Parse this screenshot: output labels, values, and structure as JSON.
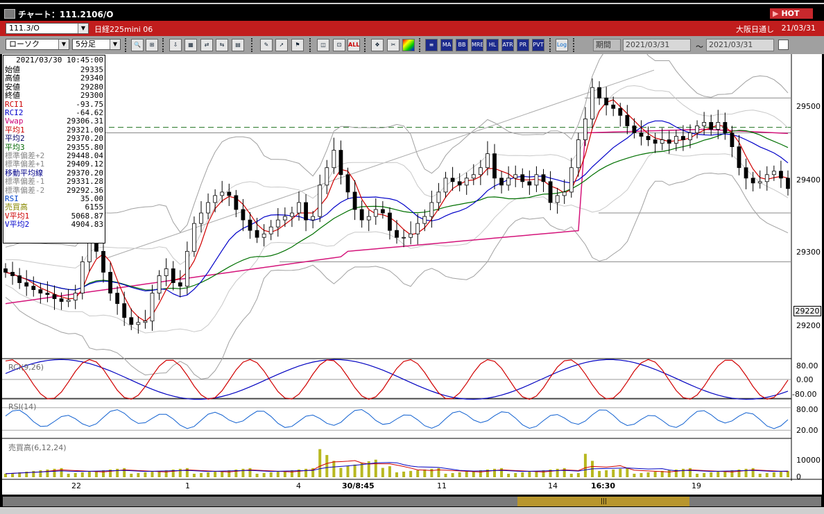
{
  "window": {
    "title": "チャート：111.2106/O",
    "hot_label": "HOT"
  },
  "info_strip": {
    "symbol_value": "111.3/O",
    "symbol_name": "日経225mini 06",
    "chart_type": "ローソク",
    "interval": "5分足",
    "market": "大阪日通し",
    "date": "21/03/31"
  },
  "toolbar": {
    "icons": [
      "zoom-icon",
      "cursor-split-icon",
      "arrow-down-icon",
      "image-icon",
      "swap-icon",
      "trash-icon",
      "pen-icon",
      "arrow-select-icon",
      "flag-icon",
      "bar-shift-icon",
      "bar-split-icon",
      "all-icon",
      "lattice-icon",
      "wrench-icon",
      "palette-icon",
      "price-band-icon",
      "ma-icon",
      "bb-icon",
      "mre-icon",
      "hl-icon",
      "atr-icon",
      "pr-icon",
      "pvt-icon",
      "log-icon"
    ],
    "btn_labels": {
      "all": "ALL",
      "ma": "MA",
      "bb": "BB",
      "mre": "MRE",
      "hl": "HL",
      "atr": "ATR",
      "pr": "PR",
      "pvt": "PVT",
      "log": "Log"
    },
    "period_label": "期間",
    "date_from": "2021/03/31",
    "tilde": "〜",
    "date_to": "2021/03/31"
  },
  "info_panel": {
    "timestamp": "2021/03/30 10:45:00",
    "rows": [
      {
        "label": "始値",
        "value": "29335",
        "color": "#000000"
      },
      {
        "label": "高値",
        "value": "29340",
        "color": "#000000"
      },
      {
        "label": "安値",
        "value": "29280",
        "color": "#000000"
      },
      {
        "label": "終値",
        "value": "29300",
        "color": "#000000"
      },
      {
        "label": "RCI1",
        "value": "-93.75",
        "color": "#cc0000"
      },
      {
        "label": "RCI2",
        "value": "-64.62",
        "color": "#0000cc"
      },
      {
        "label": "Vwap",
        "value": "29306.31",
        "color": "#cc0077"
      },
      {
        "label": "平均1",
        "value": "29321.00",
        "color": "#cc0000"
      },
      {
        "label": "平均2",
        "value": "29370.20",
        "color": "#000066"
      },
      {
        "label": "平均3",
        "value": "29355.80",
        "color": "#006600"
      },
      {
        "label": "標準偏差+2",
        "value": "29448.04",
        "color": "#888888"
      },
      {
        "label": "標準偏差+1",
        "value": "29409.12",
        "color": "#888888"
      },
      {
        "label": "移動平均線",
        "value": "29370.20",
        "color": "#000088"
      },
      {
        "label": "標準偏差-1",
        "value": "29331.28",
        "color": "#888888"
      },
      {
        "label": "標準偏差-2",
        "value": "29292.36",
        "color": "#888888"
      },
      {
        "label": "RSI",
        "value": "35.00",
        "color": "#0044cc"
      },
      {
        "label": "売買高",
        "value": "6155",
        "color": "#888800"
      },
      {
        "label": "V平均1",
        "value": "5068.87",
        "color": "#cc0000"
      },
      {
        "label": "V平均2",
        "value": "4904.83",
        "color": "#0000cc"
      }
    ]
  },
  "price_axis": {
    "ticks": [
      "29500",
      "29400",
      "29300",
      "29200"
    ],
    "current_price": "29220"
  },
  "panes": {
    "rci_label": "RCI(9,26)",
    "rci_ticks": [
      "80.00",
      "0.00",
      "-80.00"
    ],
    "rsi_label": "RSI(14)",
    "rsi_ticks": [
      "80.00",
      "20.00"
    ],
    "vol_label": "売買高(6,12,24)",
    "vol_ticks": [
      "10000",
      "0"
    ]
  },
  "time_axis": {
    "labels": [
      "22",
      "1",
      "4",
      "30/8:45",
      "11",
      "14",
      "16:30",
      "19"
    ]
  },
  "colors": {
    "vwap": "#d4147a",
    "ma1": "#d00000",
    "ma2": "#0000c8",
    "ma3": "#007000",
    "bb": "#a0a0a0",
    "rci1": "#d00000",
    "rci2": "#0000c0",
    "rsi": "#1060d0",
    "vol": "#b8b820"
  },
  "chart_data": {
    "type": "candlestick",
    "ylim": [
      29160,
      29570
    ],
    "close_series": [
      29270,
      29265,
      29255,
      29250,
      29245,
      29240,
      29238,
      29232,
      29228,
      29230,
      29240,
      29285,
      29330,
      29300,
      29270,
      29240,
      29225,
      29205,
      29195,
      29198,
      29200,
      29240,
      29265,
      29275,
      29255,
      29250,
      29300,
      29340,
      29355,
      29370,
      29380,
      29385,
      29380,
      29360,
      29345,
      29330,
      29320,
      29325,
      29335,
      29345,
      29350,
      29355,
      29370,
      29345,
      29350,
      29395,
      29420,
      29445,
      29410,
      29385,
      29360,
      29345,
      29350,
      29360,
      29355,
      29330,
      29320,
      29320,
      29325,
      29340,
      29350,
      29370,
      29385,
      29405,
      29400,
      29395,
      29405,
      29410,
      29420,
      29440,
      29405,
      29395,
      29405,
      29410,
      29400,
      29395,
      29410,
      29400,
      29370,
      29380,
      29385,
      29420,
      29460,
      29490,
      29535,
      29520,
      29510,
      29505,
      29495,
      29480,
      29470,
      29465,
      29460,
      29455,
      29460,
      29455,
      29465,
      29460,
      29470,
      29480,
      29485,
      29475,
      29485,
      29470,
      29450,
      29420,
      29405,
      29398,
      29400,
      29410,
      29415,
      29405,
      29390
    ]
  }
}
